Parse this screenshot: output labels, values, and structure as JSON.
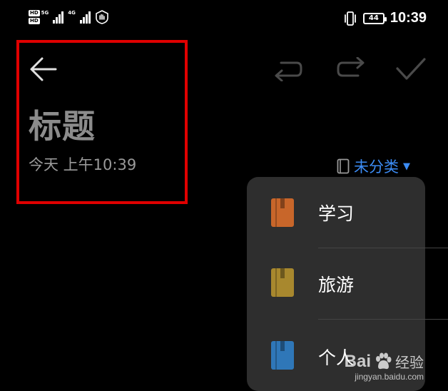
{
  "status_bar": {
    "hd_label": "HD",
    "net1": "5G",
    "net2": "4G",
    "battery": "44",
    "time": "10:39"
  },
  "toolbar": {
    "back_icon": "arrow-left-icon",
    "undo_icon": "undo-icon",
    "redo_icon": "redo-icon",
    "confirm_icon": "checkmark-icon"
  },
  "note": {
    "title": "标题",
    "date": "今天 上午10:39"
  },
  "category": {
    "selected": "未分类",
    "accent": "#3c8cf5"
  },
  "dropdown": {
    "items": [
      {
        "label": "学习",
        "color": "#c8662a"
      },
      {
        "label": "旅游",
        "color": "#a8882e"
      },
      {
        "label": "个人",
        "color": "#2f77b8"
      }
    ]
  },
  "watermark": {
    "brand": "Bai",
    "suffix": "经验",
    "url": "jingyan.baidu.com"
  },
  "highlight_color": "#e00000"
}
